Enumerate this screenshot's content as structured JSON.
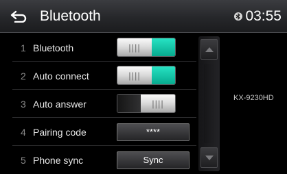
{
  "header": {
    "title": "Bluetooth",
    "back_icon": "back-arrow-icon",
    "status_icon": "bluetooth-icon",
    "time": "03:55"
  },
  "settings": {
    "items": [
      {
        "number": "1",
        "label": "Bluetooth",
        "control": "toggle",
        "state": "on"
      },
      {
        "number": "2",
        "label": "Auto connect",
        "control": "toggle",
        "state": "on"
      },
      {
        "number": "3",
        "label": "Auto answer",
        "control": "toggle",
        "state": "off"
      },
      {
        "number": "4",
        "label": "Pairing code",
        "control": "button",
        "value": "****"
      },
      {
        "number": "5",
        "label": "Phone sync",
        "control": "button",
        "value": "Sync"
      }
    ],
    "toggle_grip": "||||"
  },
  "scrollbar": {
    "up_icon": "arrow-up-icon",
    "down_icon": "arrow-down-icon"
  },
  "device": {
    "name": "KX-9230HD"
  },
  "colors": {
    "toggle_on": "#14c8a8",
    "background": "#000000",
    "header": "#2a2b2e"
  }
}
